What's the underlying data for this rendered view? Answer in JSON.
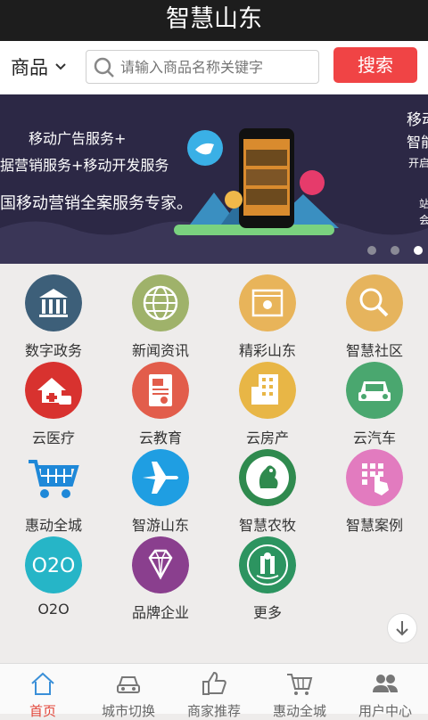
{
  "title": "智慧山东",
  "search": {
    "category": "商品",
    "placeholder": "请输入商品名称关键字",
    "button": "搜索"
  },
  "banner": {
    "line1": "移动广告服务+",
    "line2": "据营销服务+移动开发服务",
    "line3": "国移动营销全案服务专家。",
    "right1": "移动",
    "right2": "智能",
    "right3": "开启",
    "right4": "站",
    "right5": "会",
    "slides": 3,
    "active_slide": 3
  },
  "grid": [
    {
      "label": "数字政务",
      "icon": "government-building-icon",
      "color": "#3d5f79"
    },
    {
      "label": "新闻资讯",
      "icon": "globe-icon",
      "color": "#9fb26a"
    },
    {
      "label": "精彩山东",
      "icon": "picture-frame-icon",
      "color": "#e8b45a"
    },
    {
      "label": "智慧社区",
      "icon": "magnifier-icon",
      "color": "#e6b45d"
    },
    {
      "label": "云医疗",
      "icon": "medical-house-icon",
      "color": "#d8322f"
    },
    {
      "label": "云教育",
      "icon": "education-document-icon",
      "color": "#e25d4b"
    },
    {
      "label": "云房产",
      "icon": "building-icon",
      "color": "#e8b646"
    },
    {
      "label": "云汽车",
      "icon": "car-icon",
      "color": "#4aa76f"
    },
    {
      "label": "惠动全城",
      "icon": "shopping-cart-icon",
      "color": "#1e88d8"
    },
    {
      "label": "智游山东",
      "icon": "airplane-icon",
      "color": "#1f9ee2"
    },
    {
      "label": "智慧农牧",
      "icon": "rooster-icon",
      "color": "#2f8a4e"
    },
    {
      "label": "智慧案例",
      "icon": "touch-keypad-icon",
      "color": "#e27bbf"
    },
    {
      "label": "O2O",
      "icon": "o2o-icon",
      "color": "#26b5c7"
    },
    {
      "label": "品牌企业",
      "icon": "diamond-icon",
      "color": "#8a3f8e"
    },
    {
      "label": "更多",
      "icon": "more-emblem-icon",
      "color": "#2c9460"
    }
  ],
  "tabs": [
    {
      "label": "首页",
      "icon": "home-icon"
    },
    {
      "label": "城市切换",
      "icon": "car-front-icon"
    },
    {
      "label": "商家推荐",
      "icon": "thumbs-up-icon"
    },
    {
      "label": "惠动全城",
      "icon": "cart-icon"
    },
    {
      "label": "用户中心",
      "icon": "users-icon"
    }
  ],
  "o2o_text": "O2O"
}
